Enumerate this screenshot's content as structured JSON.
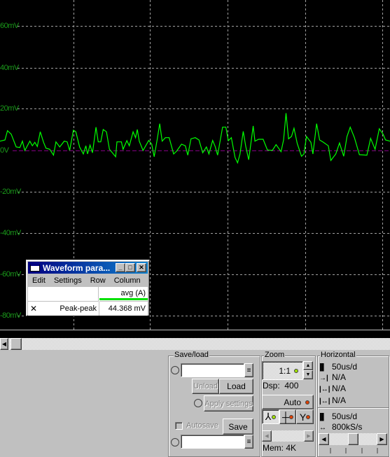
{
  "scope": {
    "y_labels": [
      "60mV",
      "40mV",
      "20mV",
      "0V",
      "-20mV",
      "-40mV",
      "-60mV",
      "-80mV"
    ],
    "trace_color": "#00ff00",
    "grid_color": "#a0a0a0",
    "zero_line_color": "#800080"
  },
  "waveform_window": {
    "title": "Waveform para...",
    "menu": [
      "Edit",
      "Settings",
      "Row",
      "Column"
    ],
    "column_header": "avg (A)",
    "column_color": "#00e000",
    "row_remove": "✕",
    "row_label": "Peak-peak",
    "row_value": "44.368 mV"
  },
  "save_load": {
    "title": "Save/load",
    "load_file": "",
    "unload": "Unload",
    "load": "Load",
    "apply_settings": "Apply settings",
    "autosave": "Autosave",
    "autosave_checked": false,
    "save": "Save",
    "save_file": ""
  },
  "zoom": {
    "title": "Zoom",
    "ratio": "1:1",
    "dsp": "Dsp:  400",
    "auto": "Auto",
    "mem": "Mem: 4K"
  },
  "horizontal": {
    "title": "Horizontal",
    "rows": [
      "50us/d",
      "N/A",
      "N/A",
      "N/A"
    ],
    "timebase": "50us/d",
    "sample_rate": "800kS/s",
    "slider_position": 0.5
  }
}
